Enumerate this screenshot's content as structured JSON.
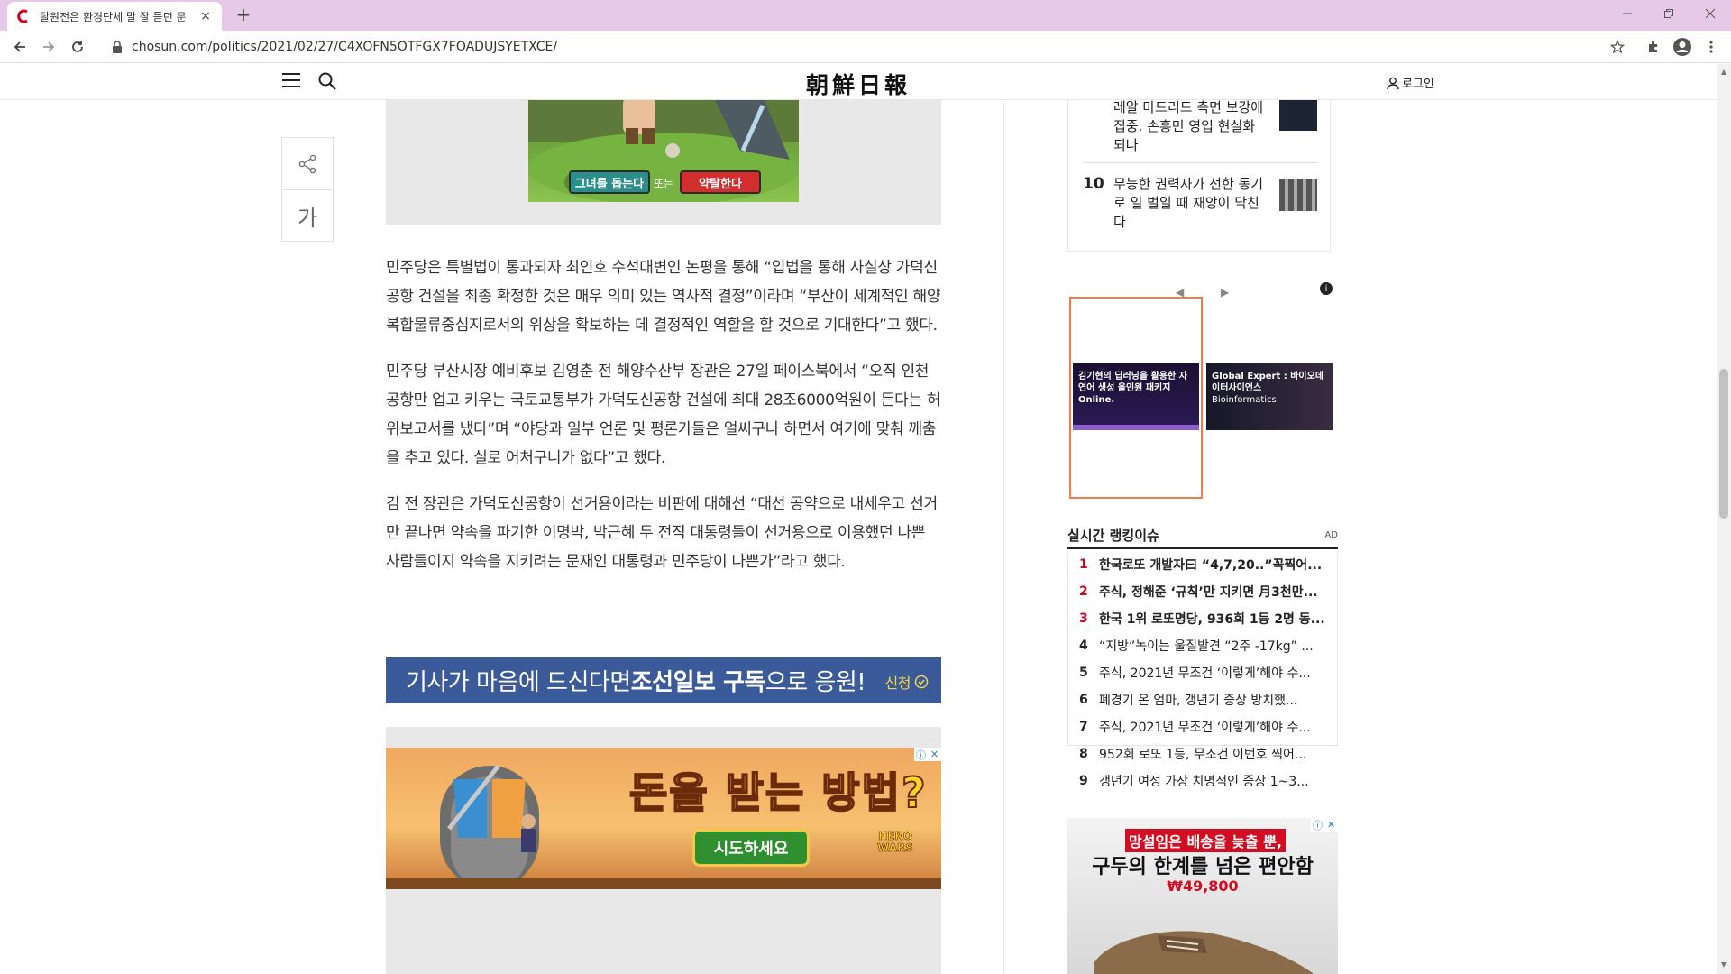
{
  "browser": {
    "tab_title": "탈원전은 환경단체 말 잘 듣던 문",
    "tab_close": "×",
    "new_tab": "+",
    "url": "chosun.com/politics/2021/02/27/C4XOFN5OTFGX7FOADUJSYETXCE/"
  },
  "header": {
    "logo": "朝鮮日報",
    "login": "로그인"
  },
  "side_tools": {
    "font_size_label": "가"
  },
  "top_ad": {
    "btn_left": "그녀를 돕는다",
    "or_text": "또는",
    "btn_right": "약탈한다"
  },
  "article": {
    "paragraphs": [
      "민주당은 특별법이 통과되자 최인호 수석대변인 논평을 통해 “입법을 통해 사실상 가덕신공항 건설을 최종 확정한 것은 매우 의미 있는 역사적 결정”이라며 “부산이 세계적인 해양 복합물류중심지로서의 위상을 확보하는 데 결정적인 역할을 할 것으로 기대한다”고 했다.",
      "민주당 부산시장 예비후보 김영춘 전 해양수산부 장관은 27일 페이스북에서 “오직 인천공항만 업고 키우는 국토교통부가 가덕도신공항 건설에 최대 28조6000억원이 든다는 허위보고서를 냈다”며 “야당과 일부 언론 및 평론가들은 얼씨구나 하면서 여기에 맞춰 깨춤을 추고 있다. 실로 어처구니가 없다”고 했다.",
      "김 전 장관은 가덕도신공항이 선거용이라는 비판에 대해선 “대선 공약으로 내세우고 선거만 끝나면 약속을 파기한 이명박, 박근혜 두 전직 대통령들이 선거용으로 이용했던 나쁜 사람들이지 약속을 지키려는 문재인 대통령과 민주당이 나쁜가”라고 했다."
    ]
  },
  "subscribe_banner": {
    "text_1": "기사가 마음에 드신다면 ",
    "text_bold": "조선일보 구독",
    "text_2": "으로 응원!",
    "apply": "신청"
  },
  "bottom_ad": {
    "headline": "돈을 받는 방법?",
    "button": "시도하세요",
    "brand": "HERO WARS"
  },
  "rank_card": {
    "items": [
      {
        "num": "",
        "text": "레알 마드리드 측면 보강에 집중. 손흥민 영입 현실화되나"
      },
      {
        "num": "10",
        "text": "무능한 권력자가 선한 동기로 일 벌일 때 재앙이 닥친다"
      }
    ]
  },
  "carousel": {
    "card_1": "김기현의 딥러닝을 활용한 자연어 생성 올인원 패키지 Online.",
    "card_2_title": "Global Expert : 바이오데이터사이언스",
    "card_2_sub": "Bioinformatics",
    "info": "i"
  },
  "realtime": {
    "title": "실시간 랭킹이슈",
    "ad": "AD",
    "rows": [
      {
        "n": "1",
        "text": "한국로또 개발자曰 “4,7,20..”꼭찍어..."
      },
      {
        "n": "2",
        "text": "주식, 정해준 ‘규칙’만 지키면 月3천만..."
      },
      {
        "n": "3",
        "text": "한국 1위 로또명당, 936회 1등 2명 동..."
      },
      {
        "n": "4",
        "text": "“지방”녹이는 울질발견 “2주 -17kg” ..."
      },
      {
        "n": "5",
        "text": "주식, 2021년 무조건 ‘이렇게’해야 수..."
      },
      {
        "n": "6",
        "text": "폐경기 온 엄마, 갱년기 증상 방치했..."
      },
      {
        "n": "7",
        "text": "주식, 2021년 무조건 ‘이렇게’해야 수..."
      },
      {
        "n": "8",
        "text": "952회 로또 1등, 무조건 이번호 찍어..."
      },
      {
        "n": "9",
        "text": "갱년기 여성 가장 치명적인 증상 1~3..."
      }
    ]
  },
  "shoe_ad": {
    "tag": "망설임은 배송을 늦출 뿐,",
    "headline": "구두의 한계를 넘은 편안함",
    "price": "₩49,800"
  },
  "colors": {
    "tabbar": "#e6c9e6",
    "banner": "#3b5a9a",
    "rank_red": "#d0021b",
    "carousel_frame": "#f07c4c"
  }
}
